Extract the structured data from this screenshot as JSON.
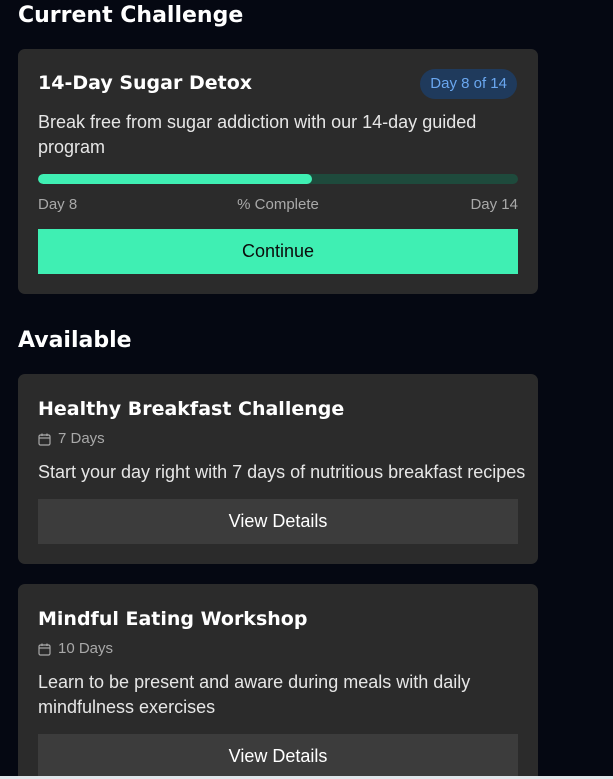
{
  "sections": {
    "current_title": "Current Challenge",
    "available_title": "Available"
  },
  "current": {
    "title": "14-Day Sugar Detox",
    "badge": "Day 8 of 14",
    "description": "Break free from sugar addiction with our 14-day guided program",
    "progress_fraction": 0.57,
    "start_label": "Day 8",
    "mid_label": "% Complete",
    "end_label": "Day 14",
    "button_label": "Continue"
  },
  "available": [
    {
      "title": "Healthy Breakfast Challenge",
      "duration": "7 Days",
      "description": "Start your day right with 7 days of nutritious breakfast recipes",
      "button_label": "View Details"
    },
    {
      "title": "Mindful Eating Workshop",
      "duration": "10 Days",
      "description": "Learn to be present and aware during meals with daily mindfulness exercises",
      "button_label": "View Details"
    }
  ],
  "icons": {
    "duration_icon": "calendar-icon"
  },
  "colors": {
    "background": "#050812",
    "card": "#2b2b2b",
    "accent": "#3fefb3",
    "badge_bg": "#1f3a5c",
    "badge_text": "#6aa7f0",
    "secondary_button": "#3c3c3c"
  }
}
